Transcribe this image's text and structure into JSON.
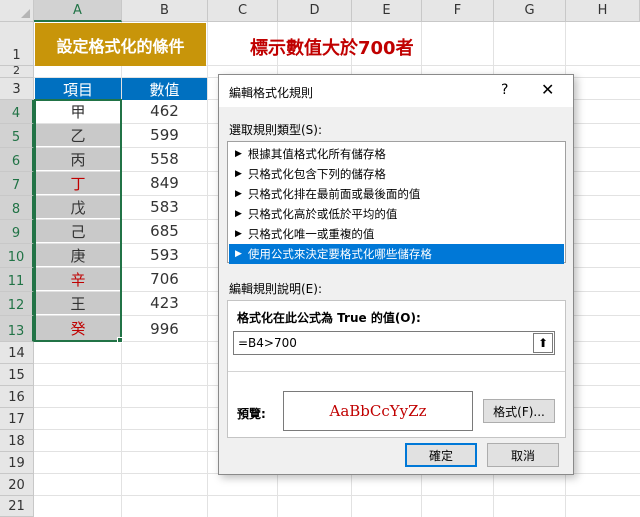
{
  "columns": [
    "A",
    "B",
    "C",
    "D",
    "E",
    "F",
    "G",
    "H"
  ],
  "rows": [
    "1",
    "2",
    "3",
    "4",
    "5",
    "6",
    "7",
    "8",
    "9",
    "10",
    "11",
    "12",
    "13",
    "14",
    "15",
    "16",
    "17",
    "18",
    "19",
    "20",
    "21"
  ],
  "sheet": {
    "title": "設定格式化的條件",
    "note": "標示數值大於700者",
    "header_a": "項目",
    "header_b": "數值",
    "items": [
      "甲",
      "乙",
      "丙",
      "丁",
      "戊",
      "己",
      "庚",
      "辛",
      "王",
      "癸"
    ],
    "values": [
      "462",
      "599",
      "558",
      "849",
      "583",
      "685",
      "593",
      "706",
      "423",
      "996"
    ],
    "highlight_color": "#c00000",
    "fill_color": "#c9c9c9",
    "accent_title": "#c8950a",
    "accent_header": "#0070c0"
  },
  "dialog": {
    "title": "編輯格式化規則",
    "help": "?",
    "close": "✕",
    "rule_type_label": "選取規則類型(S):",
    "rules": [
      "根據其值格式化所有儲存格",
      "只格式化包含下列的儲存格",
      "只格式化排在最前面或最後面的值",
      "只格式化高於或低於平均的值",
      "只格式化唯一或重複的值",
      "使用公式來決定要格式化哪些儲存格"
    ],
    "desc_label": "編輯規則說明(E):",
    "formula_label": "格式化在此公式為 True 的值(O):",
    "formula_value": "=B4>700",
    "preview_label": "預覽:",
    "preview_text": "AaBbCcYyZz",
    "format_button": "格式(F)...",
    "ok_button": "確定",
    "cancel_button": "取消"
  }
}
